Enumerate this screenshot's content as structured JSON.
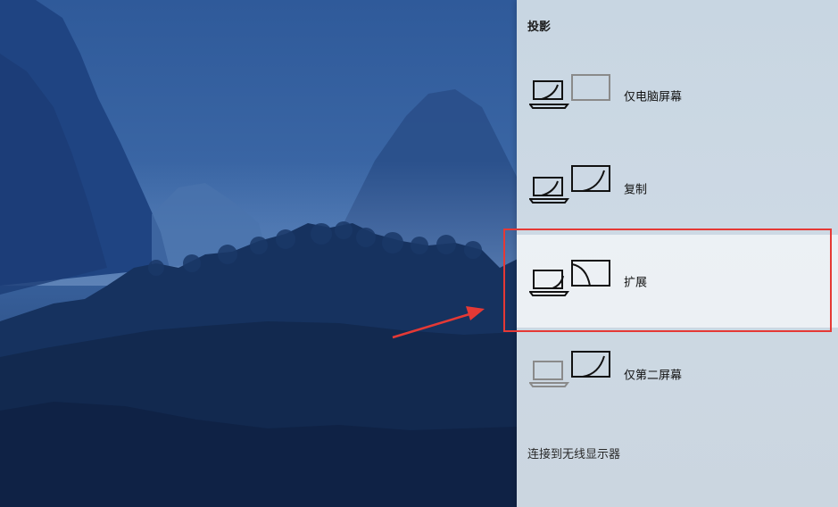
{
  "panel": {
    "title": "投影",
    "options": [
      {
        "label": "仅电脑屏幕",
        "icon": "pc-screen-only-icon",
        "selected": false
      },
      {
        "label": "复制",
        "icon": "duplicate-icon",
        "selected": false
      },
      {
        "label": "扩展",
        "icon": "extend-icon",
        "selected": true
      },
      {
        "label": "仅第二屏幕",
        "icon": "second-screen-only-icon",
        "selected": false
      }
    ],
    "wireless_link": "连接到无线显示器"
  },
  "annotation": {
    "highlight_color": "#e53935",
    "arrow_color": "#e53935"
  },
  "colors": {
    "panel_bg": "#cbd7e2",
    "selected_bg": "#ececec"
  }
}
